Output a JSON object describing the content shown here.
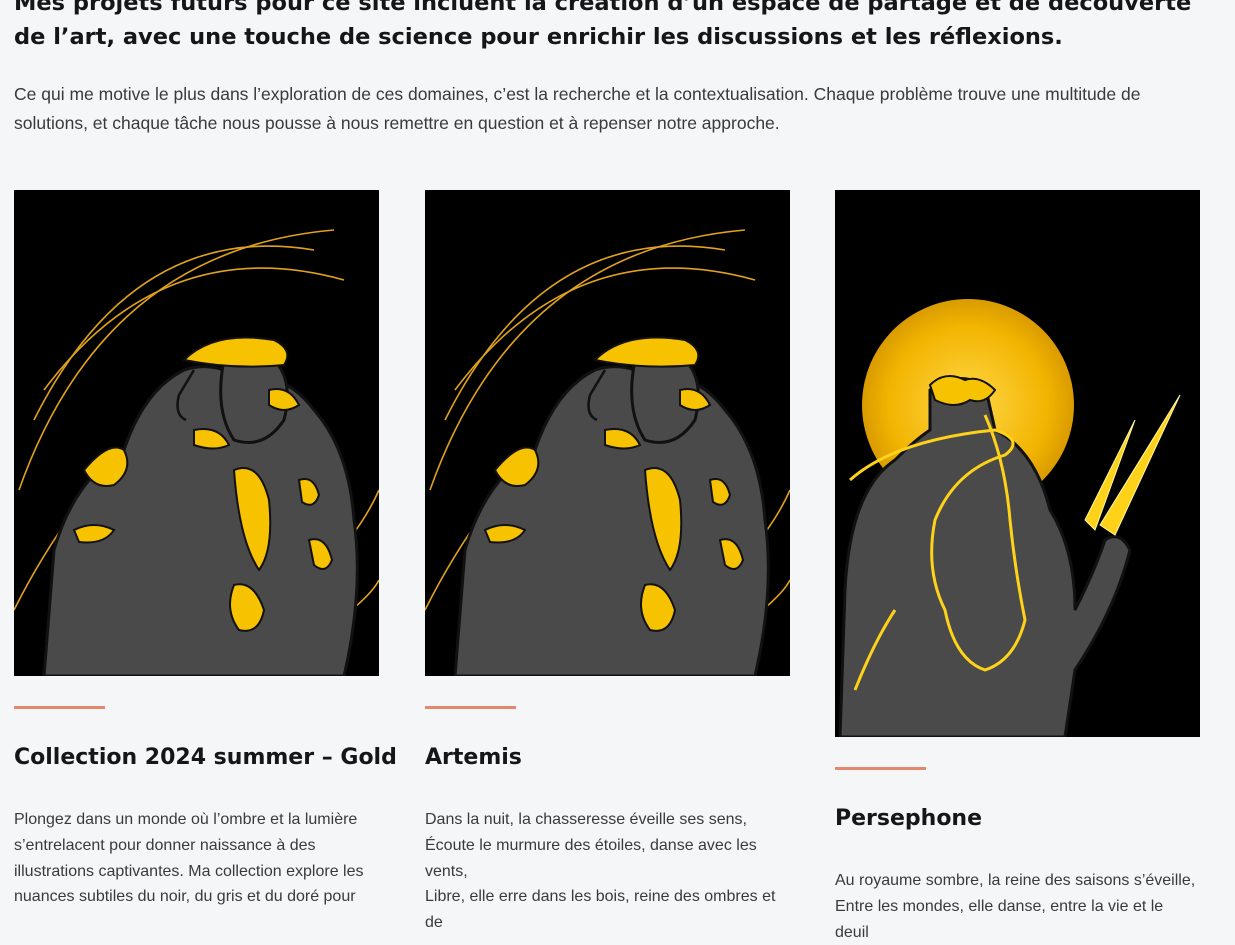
{
  "intro": {
    "heading": "Mes projets futurs pour ce site incluent la création d’un espace de partage et de découverte de l’art, avec une touche de science pour enrichir les discussions et les réflexions.",
    "paragraph": "Ce qui me motive le plus dans l’exploration de ces domaines, c’est la recherche et la contextualisation. Chaque problème trouve une multitude de solutions, et chaque tâche nous pousse à nous remettre en question et à repenser notre approche."
  },
  "colors": {
    "accent": "#e5866f",
    "gold": "#f5b800",
    "figure": "#4a4a4a",
    "background": "#f5f6f8"
  },
  "cards": [
    {
      "image_icon": "artwork-gold-embrace",
      "title": "Collection 2024 summer – Gold",
      "text": "Plongez dans un monde où l’ombre et la lumière s’entrelacent pour donner naissance à des illustrations captivantes. Ma collection explore les nuances subtiles du noir, du gris et du doré pour"
    },
    {
      "image_icon": "artwork-artemis",
      "title": "Artemis",
      "text": "Dans la nuit, la chasseresse éveille ses sens,\nÉcoute le murmure des étoiles, danse avec les vents,\nLibre, elle erre dans les bois, reine des ombres et de"
    },
    {
      "image_icon": "artwork-persephone",
      "title": "Persephone",
      "text": "Au royaume sombre, la reine des saisons s’éveille,\nEntre les mondes, elle danse, entre la vie et le deuil"
    }
  ]
}
